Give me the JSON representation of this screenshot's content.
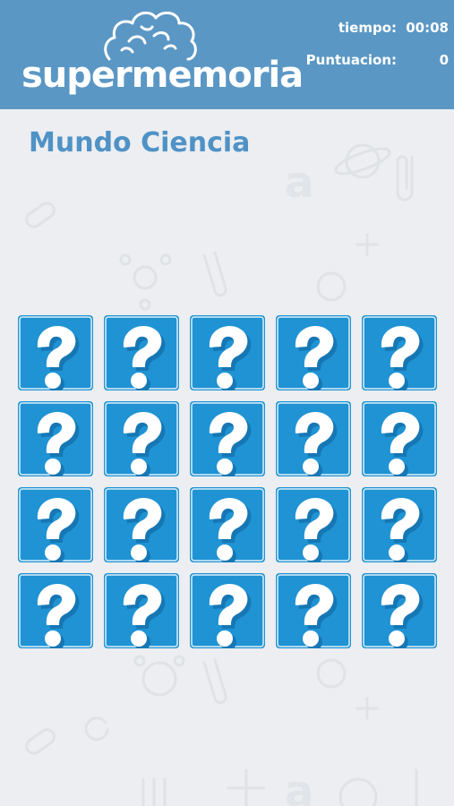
{
  "header": {
    "logo_text": "supermemoria",
    "time_label": "tiempo:",
    "time_value": "00:08",
    "score_label": "Puntuacion:",
    "score_value": "0"
  },
  "world": {
    "title": "Mundo Ciencia"
  },
  "board": {
    "rows": 4,
    "columns": 5,
    "cards": [
      {
        "face": "?",
        "state": "hidden"
      },
      {
        "face": "?",
        "state": "hidden"
      },
      {
        "face": "?",
        "state": "hidden"
      },
      {
        "face": "?",
        "state": "hidden"
      },
      {
        "face": "?",
        "state": "hidden"
      },
      {
        "face": "?",
        "state": "hidden"
      },
      {
        "face": "?",
        "state": "hidden"
      },
      {
        "face": "?",
        "state": "hidden"
      },
      {
        "face": "?",
        "state": "hidden"
      },
      {
        "face": "?",
        "state": "hidden"
      },
      {
        "face": "?",
        "state": "hidden"
      },
      {
        "face": "?",
        "state": "hidden"
      },
      {
        "face": "?",
        "state": "hidden"
      },
      {
        "face": "?",
        "state": "hidden"
      },
      {
        "face": "?",
        "state": "hidden"
      },
      {
        "face": "?",
        "state": "hidden"
      },
      {
        "face": "?",
        "state": "hidden"
      },
      {
        "face": "?",
        "state": "hidden"
      },
      {
        "face": "?",
        "state": "hidden"
      },
      {
        "face": "?",
        "state": "hidden"
      }
    ],
    "card_icon": "question-mark-icon"
  },
  "colors": {
    "header_bg": "#5b97c4",
    "title": "#4f92c6",
    "card_face": "#1f93d3",
    "card_border": "#ffffff",
    "background": "#eceef1"
  }
}
